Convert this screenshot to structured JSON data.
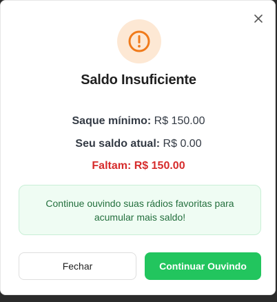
{
  "modal": {
    "title": "Saldo Insuficiente",
    "minimum_label": "Saque mínimo:",
    "minimum_value": "R$ 150.00",
    "balance_label": "Seu saldo atual:",
    "balance_value": "R$ 0.00",
    "missing_label": "Faltam:",
    "missing_value": "R$ 150.00",
    "notice": "Continue ouvindo suas rádios favoritas para acumular mais saldo!",
    "close_button": "Fechar",
    "continue_button": "Continuar Ouvindo"
  },
  "icons": {
    "header": "alert-circle-icon",
    "close": "close-icon"
  },
  "colors": {
    "accent_orange": "#f07a1a",
    "icon_bg": "#fde8d4",
    "danger": "#d62b2b",
    "success_button": "#22c55e",
    "notice_bg": "#effcf3",
    "notice_text": "#236f3d"
  }
}
